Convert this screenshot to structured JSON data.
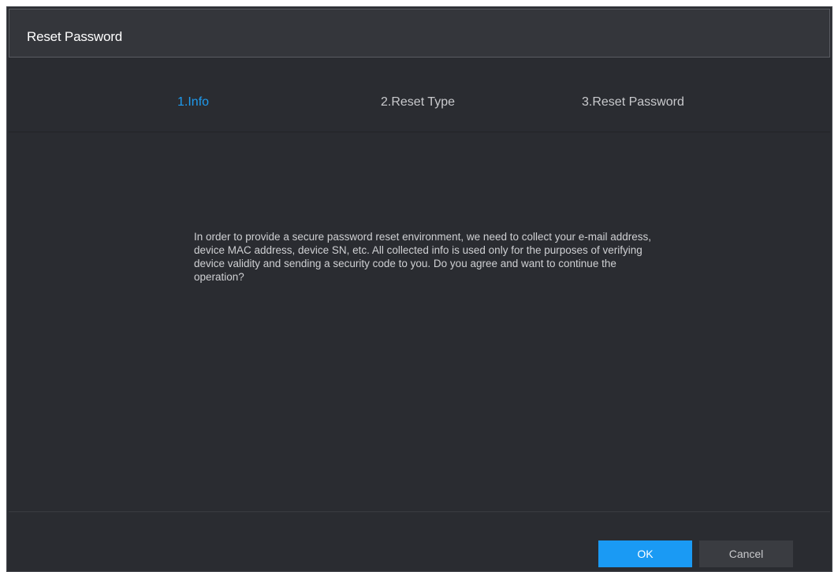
{
  "dialog": {
    "title": "Reset Password"
  },
  "steps": [
    {
      "label": "1.Info",
      "active": true
    },
    {
      "label": "2.Reset Type",
      "active": false
    },
    {
      "label": "3.Reset Password",
      "active": false
    }
  ],
  "message": "In order to provide a secure password reset environment, we need to collect your e-mail address, device MAC address, device SN, etc. All collected info is used only for the purposes of verifying device validity and sending a security code to you. Do you agree and want to continue the operation?",
  "buttons": {
    "ok_label": "OK",
    "cancel_label": "Cancel"
  },
  "colors": {
    "accent": "#1a9af4",
    "background": "#2a2c31",
    "active_step": "#1e9cf0"
  }
}
